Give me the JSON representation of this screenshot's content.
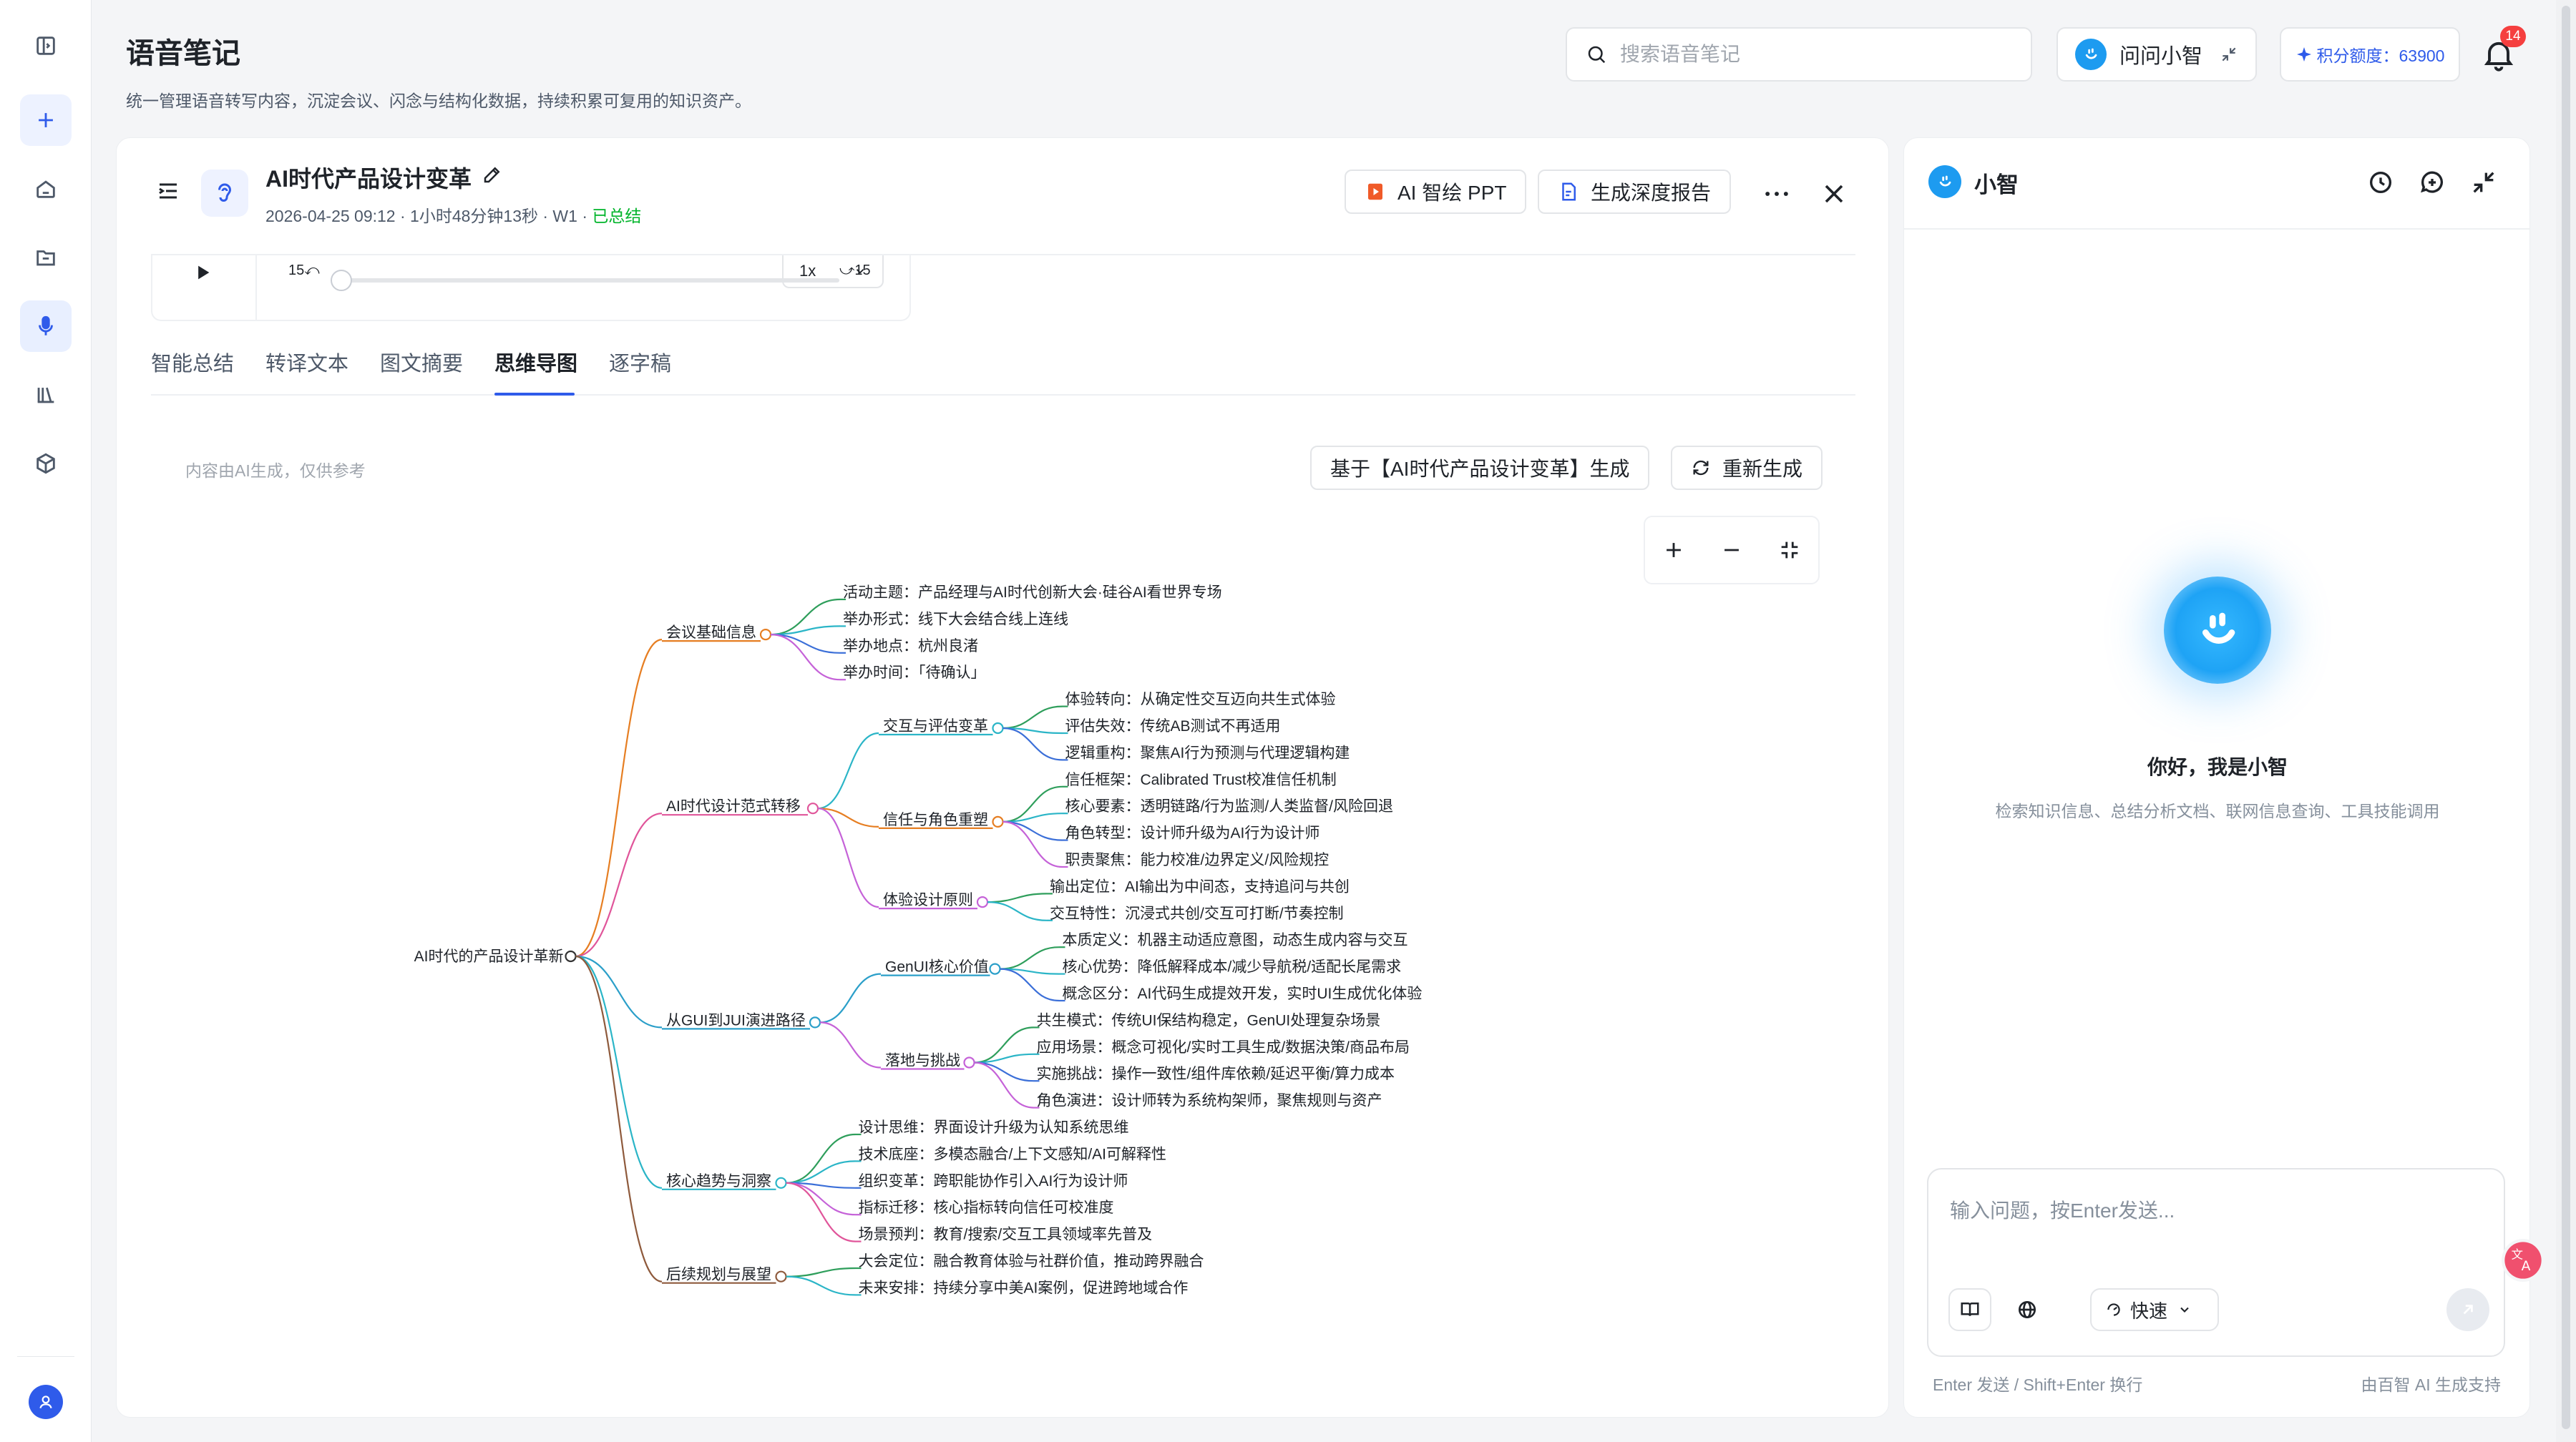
{
  "colors": {
    "accent": "#2f5bea",
    "success": "#00b42a",
    "badge": "#f53f3f",
    "brand_logo": "#1d9bf0"
  },
  "sidebar": {
    "items": [
      {
        "name": "panel-toggle-icon"
      },
      {
        "name": "plus-icon"
      },
      {
        "name": "home-icon"
      },
      {
        "name": "folder-icon"
      },
      {
        "name": "microphone-icon",
        "active": true
      },
      {
        "name": "library-icon"
      },
      {
        "name": "cube-icon"
      }
    ],
    "avatar_icon": "user-icon"
  },
  "header": {
    "title": "语音笔记",
    "subtitle": "统一管理语音转写内容，沉淀会议、闪念与结构化数据，持续积累可复用的知识资产。",
    "search_placeholder": "搜索语音笔记",
    "ask_label": "问问小智",
    "points_label": "积分额度：63900",
    "notification_count": "14"
  },
  "document": {
    "title": "AI时代产品设计变革",
    "meta": "2026-04-25 09:12 · 1小时48分钟13秒 · W1 · ",
    "status": "已总结",
    "ppt_button": "AI 智绘 PPT",
    "report_button": "生成深度报告",
    "player": {
      "skip_back": "15",
      "skip_forward": "15",
      "speed": "1x",
      "progress": 0.0
    },
    "tabs": [
      {
        "label": "智能总结"
      },
      {
        "label": "转译文本"
      },
      {
        "label": "图文摘要"
      },
      {
        "label": "思维导图",
        "active": true
      },
      {
        "label": "逐字稿"
      }
    ],
    "ai_note": "内容由AI生成，仅供参考",
    "generate_based_label": "基于【AI时代产品设计变革】生成",
    "regenerate_label": "重新生成"
  },
  "mindmap": {
    "root": "AI时代的产品设计革新",
    "branches": [
      {
        "label": "会议基础信息",
        "color": "#e67e22",
        "leaves": [
          "活动主题：产品经理与AI时代创新大会·硅谷AI看世界专场",
          "举办形式：线下大会结合线上连线",
          "举办地点：杭州良渚",
          "举办时间：「待确认」"
        ]
      },
      {
        "label": "AI时代设计范式转移",
        "color": "#e0559a",
        "subs": [
          {
            "label": "交互与评估变革",
            "color": "#2bb5c7",
            "leaves": [
              "体验转向：从确定性交互迈向共生式体验",
              "评估失效：传统AB测试不再适用",
              "逻辑重构：聚焦AI行为预测与代理逻辑构建"
            ]
          },
          {
            "label": "信任与角色重塑",
            "color": "#e67e22",
            "leaves": [
              "信任框架：Calibrated Trust校准信任机制",
              "核心要素：透明链路/行为监测/人类监督/风险回退",
              "角色转型：设计师升级为AI行为设计师",
              "职责聚焦：能力校准/边界定义/风险规控"
            ]
          },
          {
            "label": "体验设计原则",
            "color": "#c562d8",
            "leaves": [
              "输出定位：AI输出为中间态，支持追问与共创",
              "交互特性：沉浸式共创/交互可打断/节奏控制"
            ]
          }
        ]
      },
      {
        "label": "从GUI到JUI演进路径",
        "color": "#2b9fc9",
        "subs": [
          {
            "label": "GenUI核心价值",
            "color": "#2b9fc9",
            "leaves": [
              "本质定义：机器主动适应意图，动态生成内容与交互",
              "核心优势：降低解释成本/减少导航税/适配长尾需求",
              "概念区分：AI代码生成提效开发，实时UI生成优化体验"
            ]
          },
          {
            "label": "落地与挑战",
            "color": "#c562d8",
            "leaves": [
              "共生模式：传统UI保结构稳定，GenUI处理复杂场景",
              "应用场景：概念可视化/实时工具生成/数据決策/商品布局",
              "实施挑战：操作一致性/组件库依赖/延迟平衡/算力成本",
              "角色演进：设计师转为系统构架师，聚焦规则与资产"
            ]
          }
        ]
      },
      {
        "label": "核心趋势与洞察",
        "color": "#2bb5c7",
        "leaves": [
          "设计思维：界面设计升级为认知系统思维",
          "技术底座：多模态融合/上下文感知/AI可解释性",
          "组织变革：跨职能协作引入AI行为设计师",
          "指标迁移：核心指标转向信任可校准度",
          "场景预判：教育/搜索/交互工具领域率先普及"
        ]
      },
      {
        "label": "后续规划与展望",
        "color": "#8e5a3c",
        "leaves": [
          "大会定位：融合教育体验与社群价值，推动跨界融合",
          "未来安排：持续分享中美AI案例，促进跨地域合作"
        ]
      }
    ]
  },
  "assistant": {
    "title": "小智",
    "greeting": "你好，我是小智",
    "description": "检索知识信息、总结分析文档、联网信息查询、工具技能调用",
    "input_placeholder": "输入问题，按Enter发送...",
    "mode_label": "快速",
    "footer_hint": "Enter 发送 / Shift+Enter 换行",
    "footer_powered": "由百智 AI 生成支持"
  }
}
